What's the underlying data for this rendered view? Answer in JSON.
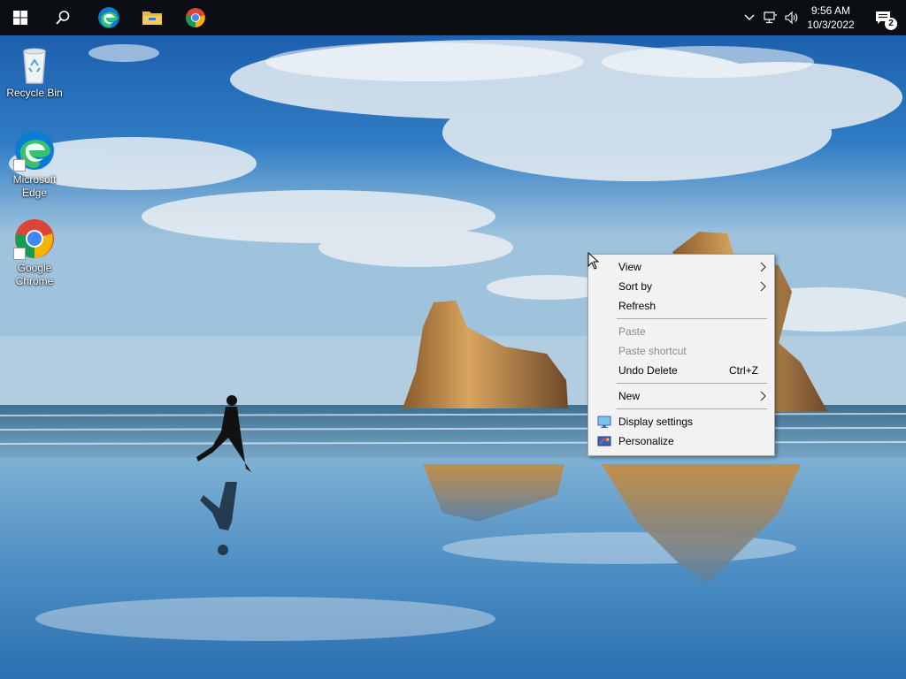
{
  "taskbar": {
    "icons": [
      "windows-logo-icon",
      "search-icon",
      "edge-icon",
      "file-explorer-icon",
      "chrome-icon"
    ],
    "time": "9:56 AM",
    "date": "10/3/2022",
    "notification_count": "2"
  },
  "desktop": {
    "icons": [
      {
        "label": "Recycle Bin"
      },
      {
        "label": "Microsoft Edge"
      },
      {
        "label": "Google Chrome"
      }
    ]
  },
  "context_menu": {
    "view": "View",
    "sort_by": "Sort by",
    "refresh": "Refresh",
    "paste": "Paste",
    "paste_shortcut": "Paste shortcut",
    "undo_delete": "Undo Delete",
    "undo_shortcut": "Ctrl+Z",
    "new": "New",
    "display_settings": "Display settings",
    "personalize": "Personalize"
  },
  "colors": {
    "taskbar": "#0b0f14",
    "menu_bg": "#f2f2f2",
    "disabled_text": "#8a8a8a"
  }
}
